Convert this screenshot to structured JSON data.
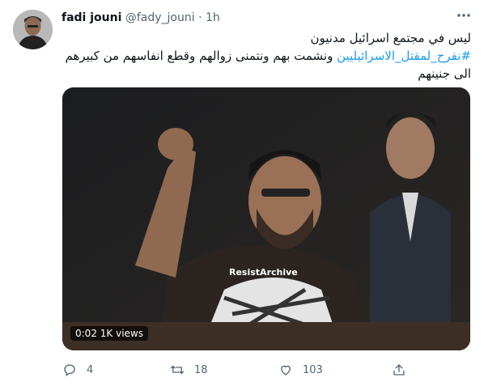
{
  "tweet": {
    "author_name": "fadi jouni",
    "handle": "@fady_jouni",
    "separator": "·",
    "time": "1h",
    "text_line1": "ليس في مجتمع اسرائيل مدنيون",
    "hashtag": "#نفرح_لمقتل_الاسرائيليين",
    "text_line2_rest": " ونشمت بهم ونتمنى زوالهم وقطع انفاسهم من كبيرهم الى جنينهم"
  },
  "media": {
    "watermark": "ResistArchive",
    "duration": "0:02",
    "views": "1K views"
  },
  "actions": {
    "reply_count": "4",
    "retweet_count": "18",
    "like_count": "103"
  }
}
